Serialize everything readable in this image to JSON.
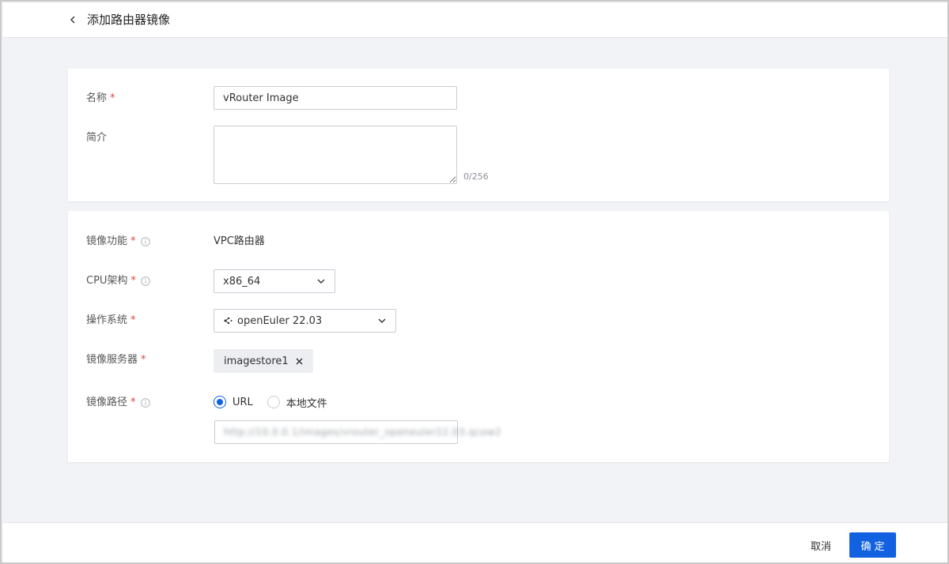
{
  "header": {
    "title": "添加路由器镜像",
    "back_icon": "chevron-left-icon"
  },
  "form": {
    "name": {
      "label": "名称",
      "required_mark": "*",
      "value": "vRouter Image"
    },
    "description": {
      "label": "简介",
      "value": "",
      "counter": "0/256"
    },
    "function": {
      "label": "镜像功能",
      "required_mark": "*",
      "value": "VPC路由器"
    },
    "cpu_arch": {
      "label": "CPU架构",
      "required_mark": "*",
      "value": "x86_64"
    },
    "os": {
      "label": "操作系统",
      "required_mark": "*",
      "value": "openEuler 22.03",
      "icon": "openeuler-logo-icon"
    },
    "image_server": {
      "label": "镜像服务器",
      "required_mark": "*",
      "tag": "imagestore1"
    },
    "image_path": {
      "label": "镜像路径",
      "required_mark": "*",
      "options": [
        {
          "label": "URL",
          "checked": true
        },
        {
          "label": "本地文件",
          "checked": false
        }
      ],
      "url_value": "http://10.0.0.1/images/vrouter_openeuler22.03.qcow2"
    }
  },
  "footer": {
    "cancel_label": "取消",
    "confirm_label": "确定"
  },
  "colors": {
    "primary": "#1261e0",
    "required": "#e0443e",
    "page_bg": "#f2f3f6"
  }
}
